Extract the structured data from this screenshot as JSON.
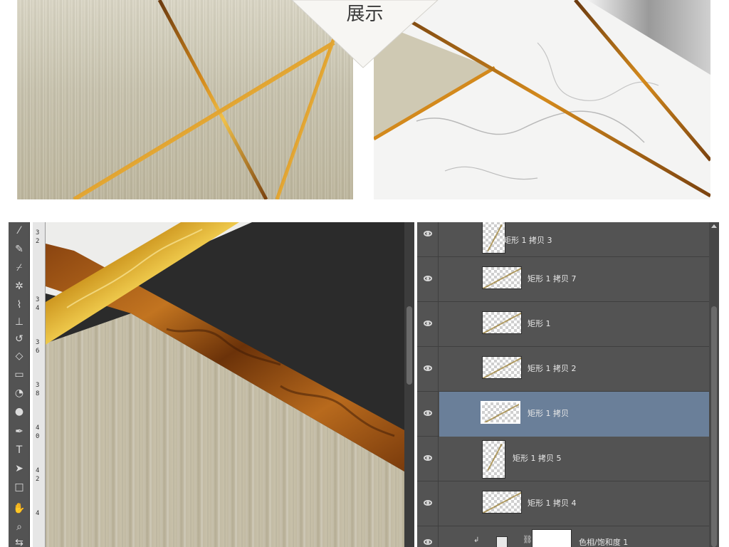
{
  "banner": {
    "text": "展示"
  },
  "toolbar": {
    "tools": [
      "magic-wand-icon",
      "eyedropper-icon",
      "color-sampler-icon",
      "healing-brush-icon",
      "brush-icon",
      "stamp-icon",
      "history-brush-icon",
      "eraser-icon",
      "gradient-icon",
      "blur-icon",
      "dodge-icon",
      "pen-icon",
      "type-icon",
      "path-select-icon",
      "rectangle-icon",
      "hand-icon",
      "zoom-icon",
      "swap-colors-icon"
    ],
    "type_tool_label": "T"
  },
  "ruler": {
    "marks": [
      "3",
      "2",
      "3",
      "4",
      "3",
      "6",
      "3",
      "8",
      "4",
      "0",
      "4",
      "2",
      "4"
    ]
  },
  "layers": {
    "rows": [
      {
        "name": "矩形 1 拷贝 3",
        "visible": true,
        "selected": false,
        "thumb": "tall"
      },
      {
        "name": "矩形 1 拷贝 7",
        "visible": true,
        "selected": false,
        "thumb": "wide"
      },
      {
        "name": "矩形 1",
        "visible": true,
        "selected": false,
        "thumb": "wide"
      },
      {
        "name": "矩形 1 拷贝 2",
        "visible": true,
        "selected": false,
        "thumb": "wide"
      },
      {
        "name": "矩形 1 拷贝",
        "visible": true,
        "selected": true,
        "thumb": "wide"
      },
      {
        "name": "矩形 1 拷贝 5",
        "visible": true,
        "selected": false,
        "thumb": "tall"
      },
      {
        "name": "矩形 1 拷贝 4",
        "visible": true,
        "selected": false,
        "thumb": "wide"
      }
    ],
    "adjustment": {
      "name": "色相/饱和度 1",
      "visible": true
    }
  }
}
